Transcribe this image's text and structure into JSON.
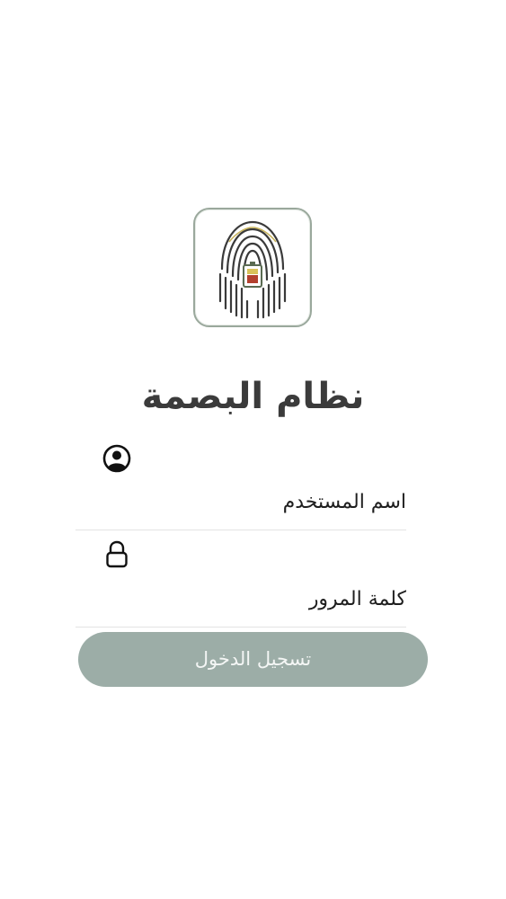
{
  "app": {
    "title": "نظام البصمة",
    "logo_icon": "fingerprint-emblem-icon"
  },
  "form": {
    "username": {
      "icon": "user-circle-icon",
      "placeholder": "اسم المستخدم",
      "value": ""
    },
    "password": {
      "icon": "lock-icon",
      "placeholder": "كلمة المرور",
      "value": ""
    },
    "login_label": "تسجيل الدخول"
  },
  "colors": {
    "button_bg": "#9cada7",
    "title_text": "#3b3b3b",
    "divider": "#e3e3e3"
  }
}
